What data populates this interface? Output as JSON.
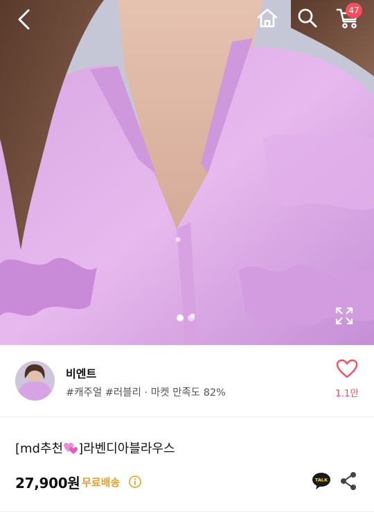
{
  "header": {
    "back_icon": "chevron-left-icon",
    "home_icon": "home-icon",
    "search_icon": "search-icon",
    "cart_icon": "cart-icon",
    "cart_count": "47"
  },
  "gallery": {
    "total_images": 2,
    "current_index": 1,
    "expand_icon": "expand-icon"
  },
  "store": {
    "name": "비엔트",
    "meta": "#캐주얼 #러블리 · 마켓 만족도 82%",
    "like_count": "1.1만"
  },
  "product": {
    "title_prefix": "[md추천",
    "title_suffix": "]라벤디아블라우스",
    "price": "27,900원",
    "shipping": "무료배송"
  },
  "colors": {
    "accent_red": "#ff4b5c",
    "shipping_gold": "#e2a02a",
    "kakao_yellow": "#fee500"
  }
}
